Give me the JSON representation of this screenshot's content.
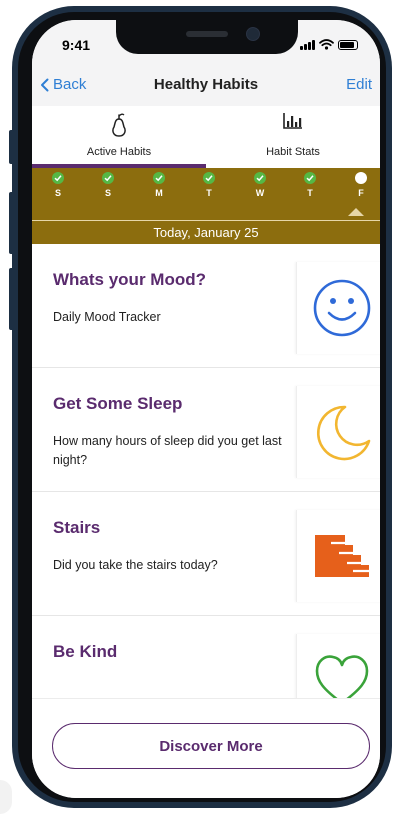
{
  "status": {
    "time": "9:41"
  },
  "nav": {
    "back_label": "Back",
    "title": "Healthy Habits",
    "edit_label": "Edit"
  },
  "tabs": [
    {
      "label": "Active Habits",
      "icon": "pear-icon",
      "active": true
    },
    {
      "label": "Habit Stats",
      "icon": "bar-chart-icon",
      "active": false
    }
  ],
  "week": {
    "days": [
      {
        "letter": "S",
        "done": true
      },
      {
        "letter": "S",
        "done": true
      },
      {
        "letter": "M",
        "done": true
      },
      {
        "letter": "T",
        "done": true
      },
      {
        "letter": "W",
        "done": true
      },
      {
        "letter": "T",
        "done": true
      },
      {
        "letter": "F",
        "done": false,
        "today": true
      }
    ],
    "date_label": "Today, January 25"
  },
  "habits": [
    {
      "title": "Whats your Mood?",
      "description": "Daily Mood Tracker",
      "icon": "smiley-face-icon",
      "color": "#2f6ad8"
    },
    {
      "title": "Get Some Sleep",
      "description": "How many hours of sleep did you get last night?",
      "icon": "crescent-moon-icon",
      "color": "#f2b630"
    },
    {
      "title": "Stairs",
      "description": "Did you take the stairs today?",
      "icon": "stairs-icon",
      "color": "#e6601b"
    },
    {
      "title": "Be Kind",
      "description": "",
      "icon": "heart-icon",
      "color": "#3aa33a"
    }
  ],
  "footer": {
    "discover_label": "Discover More"
  },
  "colors": {
    "accent": "#5a2b6e",
    "week_bar": "#8c6d0e",
    "link": "#2f7fd4",
    "check": "#55b845"
  }
}
